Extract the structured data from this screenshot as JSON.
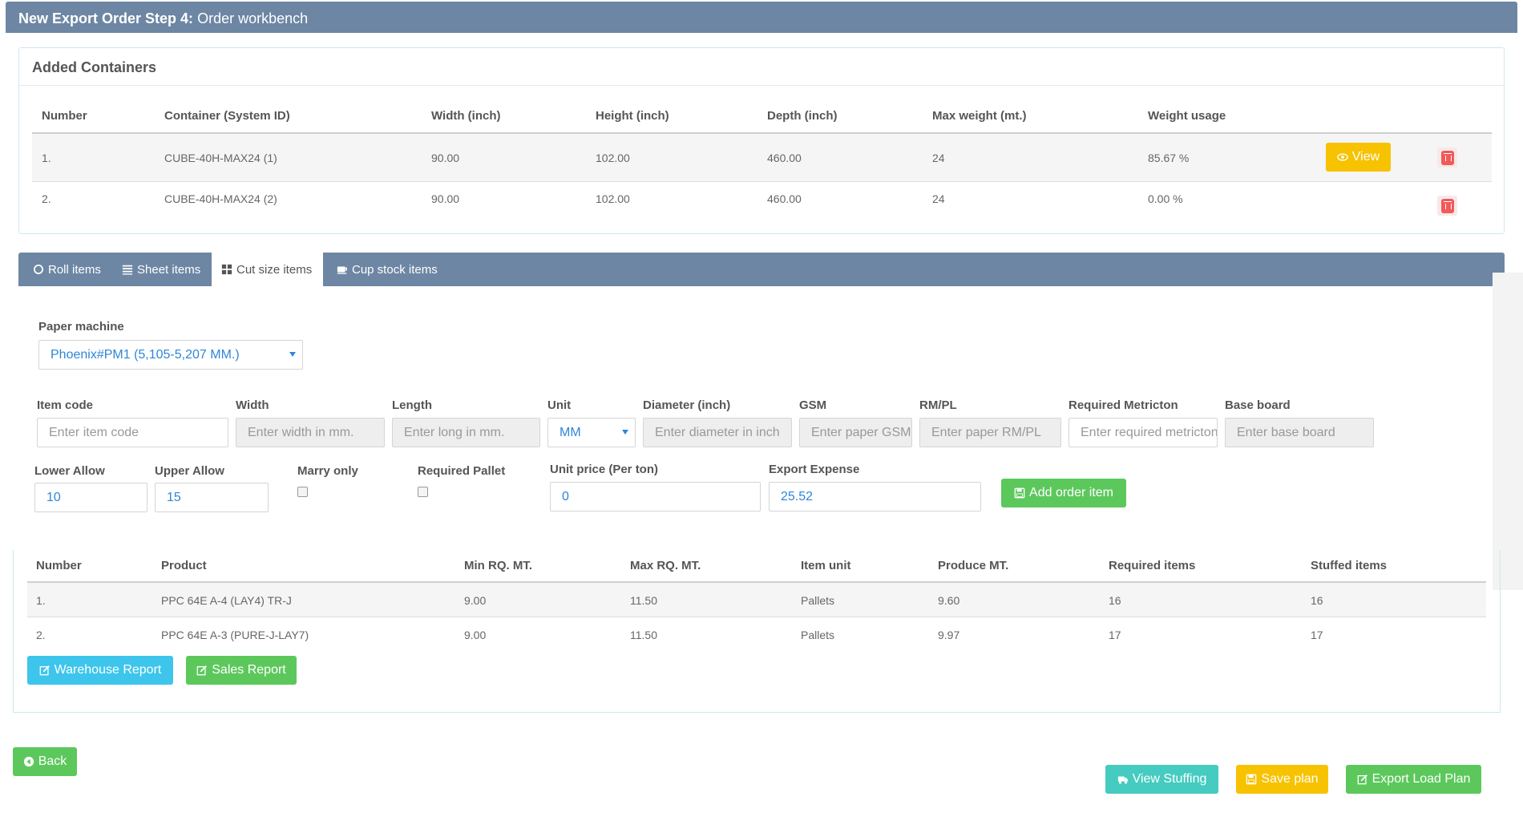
{
  "header": {
    "step": "New Export Order Step 4:",
    "title": "Order workbench"
  },
  "containers": {
    "title": "Added Containers",
    "columns": [
      "Number",
      "Container (System ID)",
      "Width (inch)",
      "Height (inch)",
      "Depth (inch)",
      "Max weight (mt.)",
      "Weight usage"
    ],
    "rows": [
      {
        "number": "1.",
        "id": "CUBE-40H-MAX24 (1)",
        "width": "90.00",
        "height": "102.00",
        "depth": "460.00",
        "max_weight": "24",
        "usage": "85.67 %"
      },
      {
        "number": "2.",
        "id": "CUBE-40H-MAX24 (2)",
        "width": "90.00",
        "height": "102.00",
        "depth": "460.00",
        "max_weight": "24",
        "usage": "0.00 %"
      }
    ],
    "view_label": "View"
  },
  "tabs": [
    "Roll items",
    "Sheet items",
    "Cut size items",
    "Cup stock items"
  ],
  "active_tab": "Cut size items",
  "form": {
    "paper_machine_label": "Paper machine",
    "paper_machine_value": "Phoenix#PM1 (5,105-5,207 MM.)",
    "item_code_label": "Item code",
    "item_code_placeholder": "Enter item code",
    "width_label": "Width",
    "width_placeholder": "Enter width in mm.",
    "length_label": "Length",
    "length_placeholder": "Enter long in mm.",
    "unit_label": "Unit",
    "unit_value": "MM",
    "diameter_label": "Diameter (inch)",
    "diameter_placeholder": "Enter diameter in inch",
    "gsm_label": "GSM",
    "gsm_placeholder": "Enter paper GSM",
    "rmpl_label": "RM/PL",
    "rmpl_placeholder": "Enter paper RM/PL",
    "required_metricton_label": "Required Metricton",
    "required_metricton_placeholder": "Enter required metricton",
    "base_board_label": "Base board",
    "base_board_placeholder": "Enter base board",
    "lower_allow_label": "Lower Allow",
    "lower_allow_value": "10",
    "upper_allow_label": "Upper Allow",
    "upper_allow_value": "15",
    "marry_only_label": "Marry only",
    "required_pallet_label": "Required Pallet",
    "unit_price_label": "Unit price (Per ton)",
    "unit_price_value": "0",
    "export_expense_label": "Export Expense",
    "export_expense_value": "25.52",
    "add_order_item_label": "Add order item"
  },
  "items": {
    "columns": [
      "Number",
      "Product",
      "Min RQ. MT.",
      "Max RQ. MT.",
      "Item unit",
      "Produce MT.",
      "Required items",
      "Stuffed items"
    ],
    "rows": [
      {
        "number": "1.",
        "product": "PPC 64E A-4 (LAY4) TR-J",
        "min": "9.00",
        "max": "11.50",
        "unit": "Pallets",
        "produce": "9.60",
        "required": "16",
        "stuffed": "16"
      },
      {
        "number": "2.",
        "product": "PPC 64E A-3 (PURE-J-LAY7)",
        "min": "9.00",
        "max": "11.50",
        "unit": "Pallets",
        "produce": "9.97",
        "required": "17",
        "stuffed": "17"
      }
    ],
    "warehouse_report_label": "Warehouse Report",
    "sales_report_label": "Sales Report"
  },
  "footer": {
    "back_label": "Back",
    "view_stuffing_label": "View Stuffing",
    "save_plan_label": "Save plan",
    "export_load_plan_label": "Export Load Plan"
  },
  "colors": {
    "header": "#6d86a3",
    "yellow": "#f7c200",
    "green": "#5cc85c",
    "blue": "#3dc5ec",
    "teal": "#45cbc0",
    "danger": "#f05a5a",
    "value_text": "#2f86d8"
  }
}
